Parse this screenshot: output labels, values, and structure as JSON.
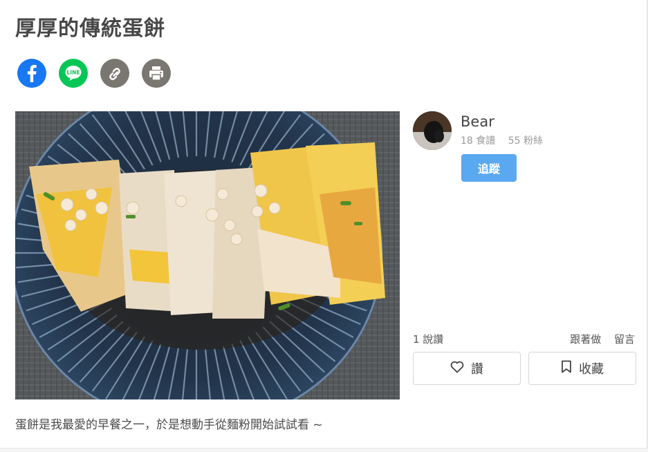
{
  "recipe": {
    "title": "厚厚的傳統蛋餅",
    "description": "蛋餅是我最愛的早餐之一，於是想動手從麵粉開始試試看 ~"
  },
  "share": {
    "facebook": {
      "icon": "facebook-icon",
      "color": "#1877f2"
    },
    "line": {
      "icon": "line-icon",
      "label": "LINE",
      "color": "#06c755"
    },
    "copy_link": {
      "icon": "link-icon",
      "color": "#7a7672"
    },
    "print": {
      "icon": "printer-icon",
      "color": "#7a7672"
    }
  },
  "author": {
    "name": "Bear",
    "recipes": "18 食譜",
    "followers": "55 粉絲",
    "follow_label": "追蹤"
  },
  "stats": {
    "likes": "1 說讚",
    "cook_along": "跟著做",
    "comment": "留言"
  },
  "actions": {
    "like_label": "讚",
    "like_icon": "heart-icon",
    "save_label": "收藏",
    "save_icon": "bookmark-icon"
  },
  "colors": {
    "accent": "#5aa9f0"
  }
}
